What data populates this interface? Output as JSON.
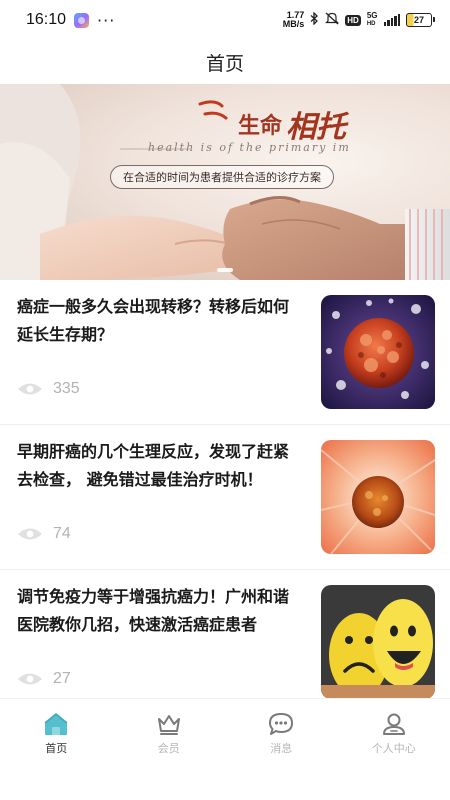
{
  "status_bar": {
    "time": "16:10",
    "net_speed_value": "1.77",
    "net_speed_unit": "MB/s",
    "hd_label": "HD",
    "signal_label_top": "5G",
    "signal_label_bottom": "HD",
    "battery": "27",
    "icons": [
      "app-badge-icon",
      "more-icon",
      "bluetooth-icon",
      "mute-icon",
      "hd-icon",
      "signal-icon",
      "battery-icon"
    ]
  },
  "header": {
    "title": "首页"
  },
  "banner": {
    "headline_small": "生命",
    "headline_big": "相托",
    "english": "health is of the primary im",
    "tagline": "在合适的时间为患者提供合适的诊疗方案"
  },
  "news": [
    {
      "title": "癌症一般多久会出现转移？转移后如何延长生存期？",
      "views": "335",
      "thumb": "cancer-cell-image"
    },
    {
      "title": "早期肝癌的几个生理反应，发现了赶紧去检查， 避免错过最佳治疗时机！",
      "views": "74",
      "thumb": "liver-cancer-cell-image"
    },
    {
      "title": "调节免疫力等于增强抗癌力！广州和谐医院教你几招，快速激活癌症患者",
      "views": "27",
      "thumb": "smile-sad-faces-image"
    }
  ],
  "tabs": [
    {
      "label": "首页",
      "icon": "home-icon",
      "active": true
    },
    {
      "label": "会员",
      "icon": "crown-icon",
      "active": false
    },
    {
      "label": "消息",
      "icon": "message-icon",
      "active": false
    },
    {
      "label": "个人中心",
      "icon": "user-icon",
      "active": false
    }
  ],
  "colors": {
    "accent": "#4fb8c8",
    "headline_red": "#a3351f",
    "muted": "#b3b3b3"
  }
}
